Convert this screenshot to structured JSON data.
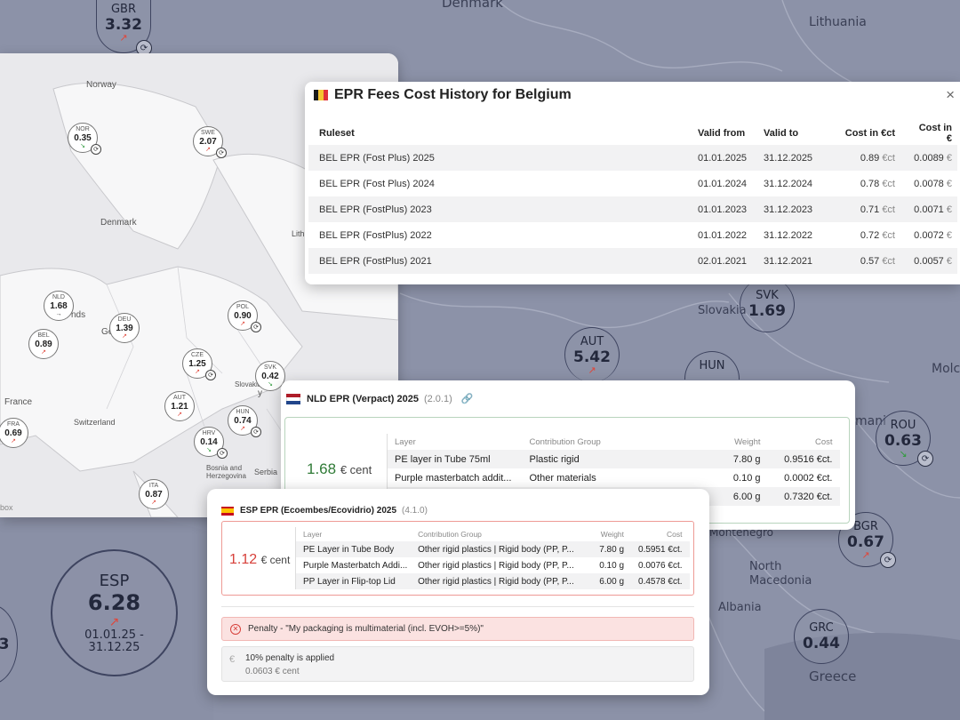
{
  "background_map": {
    "countries": [
      "Denmark",
      "Lithuania",
      "Slovakia",
      "Molc",
      "mani",
      "Montenegro",
      "North Macedonia",
      "Albania",
      "Greece"
    ],
    "markers": [
      {
        "code": "GBR",
        "value": "3.32",
        "trend": "up",
        "sync": true
      },
      {
        "code": "SVK",
        "value": "1.69",
        "trend": "",
        "sync": false
      },
      {
        "code": "AUT",
        "value": "5.42",
        "trend": "up",
        "sync": false
      },
      {
        "code": "HUN",
        "value": "",
        "trend": "",
        "sync": false
      },
      {
        "code": "ROU",
        "value": "0.63",
        "trend": "down",
        "sync": true
      },
      {
        "code": "BGR",
        "value": "0.67",
        "trend": "up",
        "sync": true
      },
      {
        "code": "GRC",
        "value": "0.44",
        "trend": "",
        "sync": false
      },
      {
        "code": "ESP",
        "value": "6.28",
        "trend": "up",
        "sync": false,
        "period": "01.01.25 - 31.12.25"
      }
    ]
  },
  "europe_map": {
    "countries": [
      "Norway",
      "Denmark",
      "France",
      "Switzerland",
      "Slovakia",
      "Bosnia and Herzegovina",
      "Serbia",
      "Lith",
      "Ge",
      "nds",
      "y"
    ],
    "markers": [
      {
        "code": "NOR",
        "value": "0.35",
        "trend": "down",
        "sync": true
      },
      {
        "code": "SWE",
        "value": "2.07",
        "trend": "up",
        "sync": true
      },
      {
        "code": "NLD",
        "value": "1.68",
        "trend": "flat",
        "sync": false
      },
      {
        "code": "DEU",
        "value": "1.39",
        "trend": "up",
        "sync": false
      },
      {
        "code": "POL",
        "value": "0.90",
        "trend": "up",
        "sync": true
      },
      {
        "code": "BEL",
        "value": "0.89",
        "trend": "up",
        "sync": false
      },
      {
        "code": "CZE",
        "value": "1.25",
        "trend": "up",
        "sync": true
      },
      {
        "code": "SVK",
        "value": "0.42",
        "trend": "down",
        "sync": false
      },
      {
        "code": "AUT",
        "value": "1.21",
        "trend": "up",
        "sync": false
      },
      {
        "code": "HUN",
        "value": "0.74",
        "trend": "up",
        "sync": true
      },
      {
        "code": "FRA",
        "value": "0.69",
        "trend": "up",
        "sync": false
      },
      {
        "code": "HRV",
        "value": "0.14",
        "trend": "down",
        "sync": true
      },
      {
        "code": "ITA",
        "value": "0.87",
        "trend": "up",
        "sync": false
      }
    ],
    "attribution": "box"
  },
  "belgium": {
    "title": "EPR Fees Cost History for Belgium",
    "close": "×",
    "columns": [
      "Ruleset",
      "Valid from",
      "Valid to",
      "Cost in €ct",
      "Cost in €"
    ],
    "rows": [
      {
        "ruleset": "BEL EPR (Fost Plus) 2025",
        "from": "01.01.2025",
        "to": "31.12.2025",
        "ct": "0.89",
        "eur": "0.0089"
      },
      {
        "ruleset": "BEL EPR (Fost Plus) 2024",
        "from": "01.01.2024",
        "to": "31.12.2024",
        "ct": "0.78",
        "eur": "0.0078"
      },
      {
        "ruleset": "BEL EPR (FostPlus) 2023",
        "from": "01.01.2023",
        "to": "31.12.2023",
        "ct": "0.71",
        "eur": "0.0071"
      },
      {
        "ruleset": "BEL EPR (FostPlus) 2022",
        "from": "01.01.2022",
        "to": "31.12.2022",
        "ct": "0.72",
        "eur": "0.0072"
      },
      {
        "ruleset": "BEL EPR (FostPlus) 2021",
        "from": "02.01.2021",
        "to": "31.12.2021",
        "ct": "0.57",
        "eur": "0.0057"
      }
    ],
    "unit_ct": "€ct",
    "unit_eur": "€"
  },
  "netherlands": {
    "title": "NLD EPR (Verpact) 2025",
    "version": "(2.0.1)",
    "total_value": "1.68",
    "total_unit": "€ cent",
    "columns": [
      "Layer",
      "Contribution Group",
      "Weight",
      "Cost"
    ],
    "rows": [
      {
        "layer": "PE layer in Tube 75ml",
        "group": "Plastic rigid",
        "weight": "7.80 g",
        "cost": "0.9516 €ct."
      },
      {
        "layer": "Purple masterbatch addit...",
        "group": "Other materials",
        "weight": "0.10 g",
        "cost": "0.0002 €ct."
      },
      {
        "layer": "",
        "group": "",
        "weight": "6.00 g",
        "cost": "0.7320 €ct."
      }
    ]
  },
  "spain": {
    "title": "ESP EPR (Ecoembes/Ecovidrio) 2025",
    "version": "(4.1.0)",
    "total_value": "1.12",
    "total_unit": "€ cent",
    "columns": [
      "Layer",
      "Contribution Group",
      "Weight",
      "Cost"
    ],
    "rows": [
      {
        "layer": "PE Layer in Tube Body",
        "group": "Other rigid plastics | Rigid body (PP, P...",
        "weight": "7.80 g",
        "cost": "0.5951 €ct."
      },
      {
        "layer": "Purple Masterbatch Addi...",
        "group": "Other rigid plastics | Rigid body (PP, P...",
        "weight": "0.10 g",
        "cost": "0.0076 €ct."
      },
      {
        "layer": "PP Layer in Flip-top Lid",
        "group": "Other rigid plastics | Rigid body (PP, P...",
        "weight": "6.00 g",
        "cost": "0.4578 €ct."
      }
    ],
    "penalty_text": "Penalty - \"My packaging is multimaterial (incl. EVOH>=5%)\"",
    "penalty_applied": "10% penalty is applied",
    "penalty_amount": "0.0603 € cent"
  },
  "colors": {
    "up": "#e0463a",
    "down": "#2f9b3c",
    "nld_accent": "#2f7a36",
    "esp_accent": "#d7403a"
  }
}
